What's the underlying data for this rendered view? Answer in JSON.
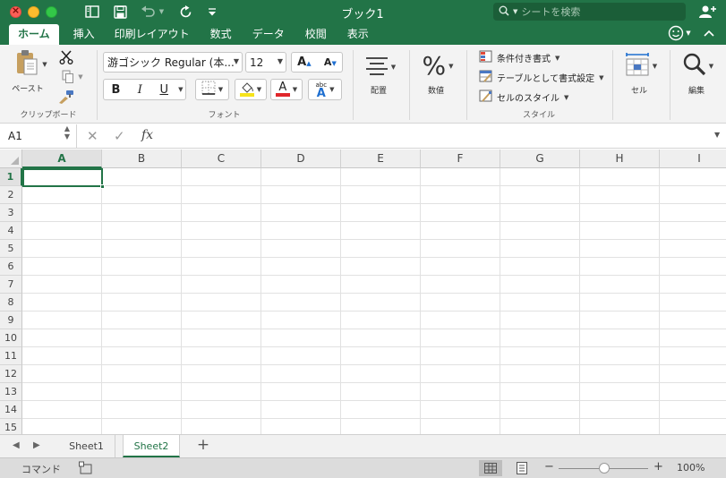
{
  "window": {
    "title": "ブック1"
  },
  "search": {
    "placeholder": "シートを検索"
  },
  "tabs": [
    "ホーム",
    "挿入",
    "印刷レイアウト",
    "数式",
    "データ",
    "校閲",
    "表示"
  ],
  "ribbon": {
    "clipboard": {
      "paste_label": "ペースト",
      "group_label": "クリップボード"
    },
    "font": {
      "font_name": "游ゴシック Regular (本...",
      "font_size": "12",
      "bold": "B",
      "italic": "I",
      "underline": "U",
      "group_label": "フォント",
      "highlight_color": "#f6e31a",
      "font_color": "#e0262a"
    },
    "alignment": {
      "label": "配置"
    },
    "number": {
      "label": "数値"
    },
    "styles": {
      "conditional": "条件付き書式",
      "table": "テーブルとして書式設定",
      "cell_styles": "セルのスタイル",
      "group_label": "スタイル"
    },
    "cells": {
      "label": "セル"
    },
    "edit": {
      "label": "編集"
    }
  },
  "formula_bar": {
    "name_box": "A1",
    "fx": "fx",
    "content": ""
  },
  "grid": {
    "columns": [
      "A",
      "B",
      "C",
      "D",
      "E",
      "F",
      "G",
      "H",
      "I"
    ],
    "rows": [
      "1",
      "2",
      "3",
      "4",
      "5",
      "6",
      "7",
      "8",
      "9",
      "10",
      "11",
      "12",
      "13",
      "14",
      "15"
    ],
    "selected_cell": "A1"
  },
  "sheets": [
    "Sheet1",
    "Sheet2"
  ],
  "active_sheet": "Sheet2",
  "status": {
    "mode": "コマンド",
    "zoom": "100%"
  },
  "colors": {
    "accent": "#227447"
  }
}
